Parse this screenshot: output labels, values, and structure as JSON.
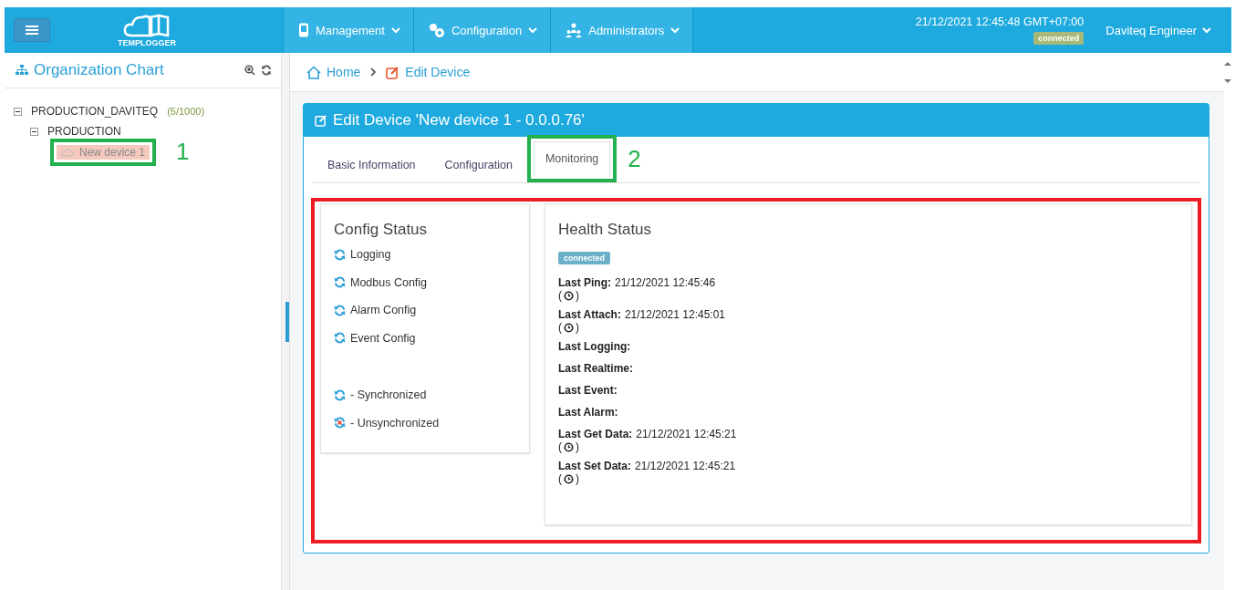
{
  "header": {
    "logo": "TEMPLOGGER",
    "nav": [
      {
        "label": "Management",
        "kind": "phone"
      },
      {
        "label": "Configuration",
        "kind": "gears"
      },
      {
        "label": "Administrators",
        "kind": "people"
      }
    ],
    "datetime": "21/12/2021 12:45:48 GMT+07:00",
    "status": "connected",
    "user": "Daviteq Engineer"
  },
  "sidebar": {
    "title": "Organization Chart",
    "tree": [
      {
        "label": "PRODUCTION_DAVITEQ",
        "count": "(5/1000)",
        "expanded": true,
        "selected": false,
        "children": [
          {
            "label": "PRODUCTION",
            "expanded": true,
            "selected": false,
            "children": [
              {
                "label": "New device 1",
                "selected": true,
                "callout": "1"
              }
            ]
          }
        ]
      }
    ]
  },
  "breadcrumb": [
    {
      "label": "Home",
      "kind": "home"
    },
    {
      "label": "Edit Device",
      "kind": "edit"
    }
  ],
  "card": {
    "title": "Edit Device 'New device 1 - 0.0.0.76'",
    "tabs": [
      {
        "label": "Basic Information",
        "selected": false
      },
      {
        "label": "Configuration",
        "selected": false
      },
      {
        "label": "Monitoring",
        "selected": true,
        "callout": "2"
      }
    ],
    "outlined": true
  },
  "config_status": {
    "title": "Config Status",
    "items": [
      {
        "label": "Logging",
        "synced": true
      },
      {
        "label": "Modbus Config",
        "synced": true
      },
      {
        "label": "Alarm Config",
        "synced": true
      },
      {
        "label": "Event Config",
        "synced": true
      }
    ],
    "legend": [
      {
        "label": "- Synchronized",
        "synced": true
      },
      {
        "label": "- Unsynchronized",
        "synced": false
      }
    ]
  },
  "health_status": {
    "title": "Health Status",
    "status": "connected",
    "rows": [
      {
        "label": "Last Ping:",
        "value": "21/12/2021 12:45:46",
        "note": [
          "(",
          ")"
        ]
      },
      {
        "label": "Last Attach:",
        "value": "21/12/2021 12:45:01",
        "note": [
          "(",
          ")"
        ]
      },
      {
        "label": "Last Logging:"
      },
      {
        "label": "Last Realtime:"
      },
      {
        "label": "Last Event:"
      },
      {
        "label": "Last Alarm:"
      },
      {
        "label": "Last Get Data:",
        "value": "21/12/2021 12:45:21",
        "note": [
          "(",
          ")"
        ]
      },
      {
        "label": "Last Set Data:",
        "value": "21/12/2021 12:45:21",
        "note": [
          "(",
          ")"
        ]
      }
    ]
  }
}
